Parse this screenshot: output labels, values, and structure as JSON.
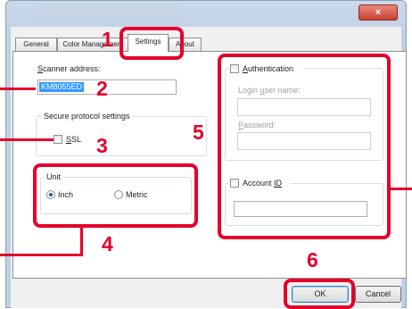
{
  "window": {
    "close_symbol": "×"
  },
  "tabs": [
    "General",
    "Color Management",
    "Settings",
    "About"
  ],
  "active_tab": "Settings",
  "scanner_address": {
    "label_under": "S",
    "label_rest": "canner address:",
    "value": "KM8055ED"
  },
  "secure_protocol": {
    "legend": "Secure protocol settings",
    "ssl_under": "S",
    "ssl_rest": "SL",
    "ssl_checked": false
  },
  "unit": {
    "legend": "Unit",
    "inch": "Inch",
    "metric": "Metric",
    "selected": "Inch"
  },
  "authentication": {
    "label_under": "A",
    "label_rest": "uthentication",
    "checked": false,
    "login_pre": "Login ",
    "login_under": "u",
    "login_post": "ser name:",
    "login_value": "",
    "password_under": "P",
    "password_rest": "assword:",
    "password_value": ""
  },
  "account": {
    "label_pre": "Account ",
    "label_under": "ID",
    "checked": false,
    "value": ""
  },
  "buttons": {
    "ok": "OK",
    "cancel": "Cancel"
  },
  "callouts": [
    "1",
    "2",
    "3",
    "4",
    "5",
    "6"
  ],
  "colors": {
    "callout": "#e4002b",
    "selection": "#3399ff",
    "radio_fill": "#1c5eb8"
  }
}
